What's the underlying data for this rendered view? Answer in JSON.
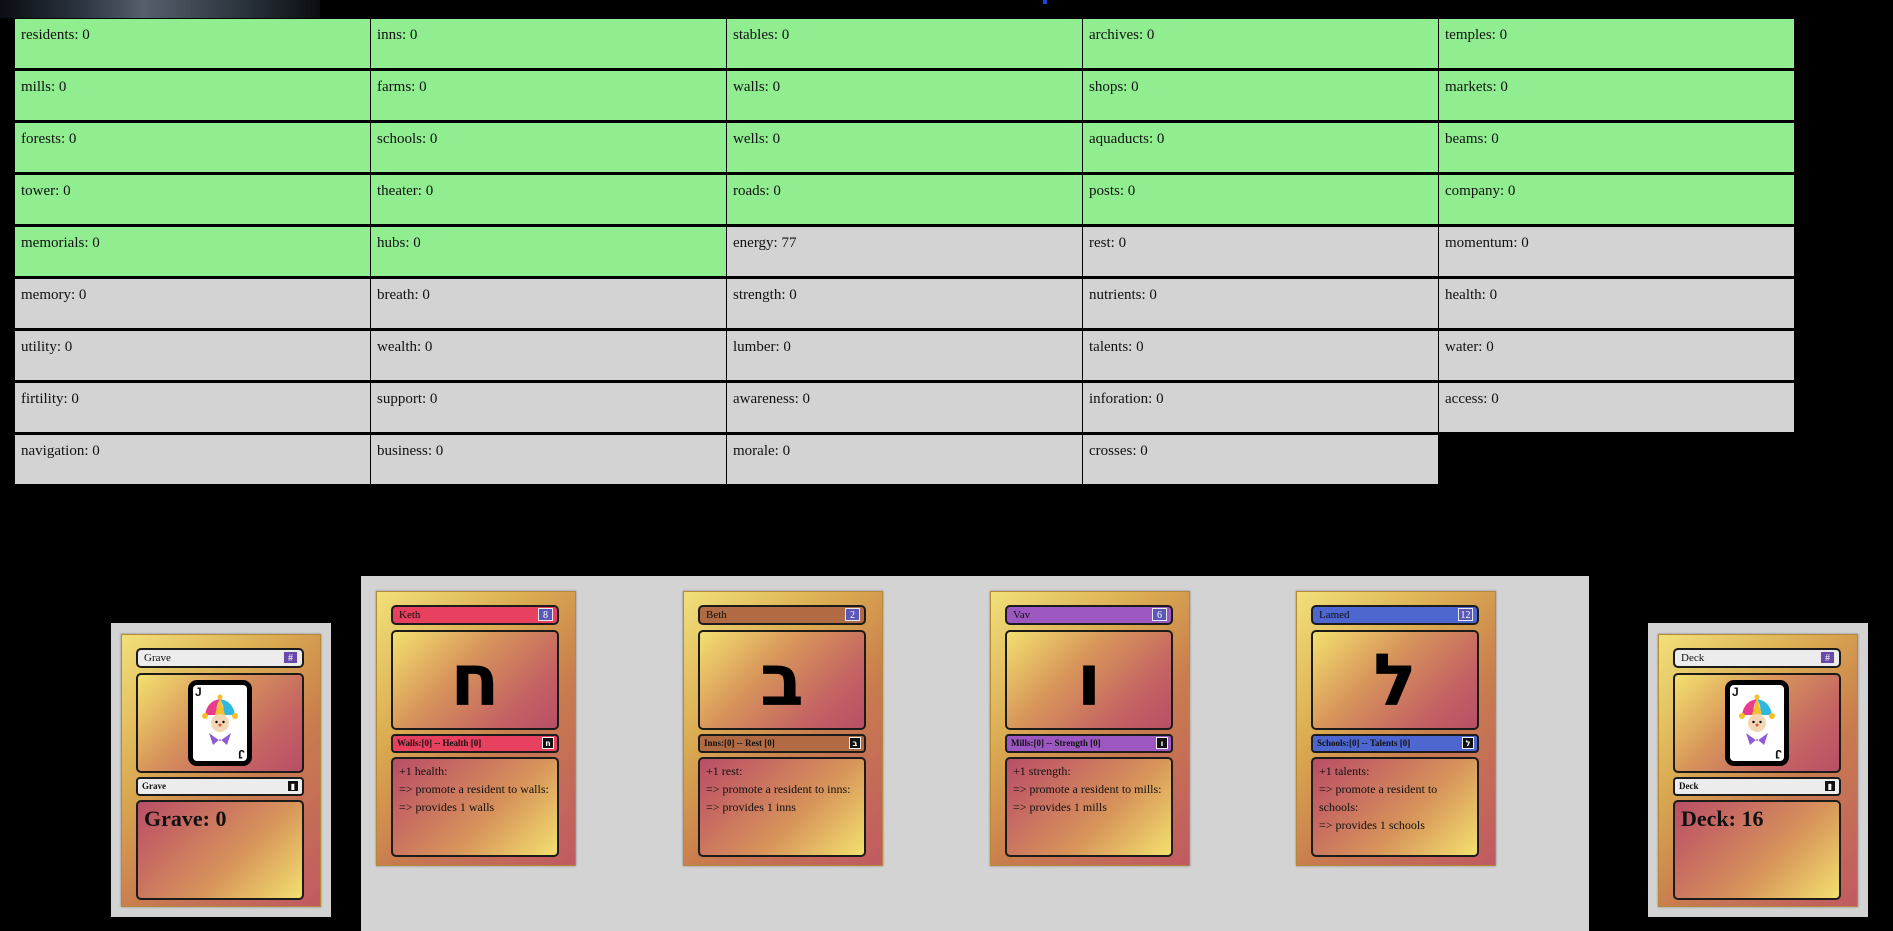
{
  "colors": {
    "built_cell": "#90ee90",
    "resource_cell": "#d3d3d3",
    "card_gold": "#e9c45e",
    "card_rose": "#c05a62"
  },
  "stats": [
    {
      "label": "residents: 0",
      "built": true
    },
    {
      "label": "inns: 0",
      "built": true
    },
    {
      "label": "stables: 0",
      "built": true
    },
    {
      "label": "archives: 0",
      "built": true
    },
    {
      "label": "temples: 0",
      "built": true
    },
    {
      "label": "mills: 0",
      "built": true
    },
    {
      "label": "farms: 0",
      "built": true
    },
    {
      "label": "walls: 0",
      "built": true
    },
    {
      "label": "shops: 0",
      "built": true
    },
    {
      "label": "markets: 0",
      "built": true
    },
    {
      "label": "forests: 0",
      "built": true
    },
    {
      "label": "schools: 0",
      "built": true
    },
    {
      "label": "wells: 0",
      "built": true
    },
    {
      "label": "aquaducts: 0",
      "built": true
    },
    {
      "label": "beams: 0",
      "built": true
    },
    {
      "label": "tower: 0",
      "built": true
    },
    {
      "label": "theater: 0",
      "built": true
    },
    {
      "label": "roads: 0",
      "built": true
    },
    {
      "label": "posts: 0",
      "built": true
    },
    {
      "label": "company: 0",
      "built": true
    },
    {
      "label": "memorials: 0",
      "built": true
    },
    {
      "label": "hubs: 0",
      "built": true
    },
    {
      "label": "energy: 77",
      "built": false
    },
    {
      "label": "rest: 0",
      "built": false
    },
    {
      "label": "momentum: 0",
      "built": false
    },
    {
      "label": "memory: 0",
      "built": false
    },
    {
      "label": "breath: 0",
      "built": false
    },
    {
      "label": "strength: 0",
      "built": false
    },
    {
      "label": "nutrients: 0",
      "built": false
    },
    {
      "label": "health: 0",
      "built": false
    },
    {
      "label": "utility: 0",
      "built": false
    },
    {
      "label": "wealth: 0",
      "built": false
    },
    {
      "label": "lumber: 0",
      "built": false
    },
    {
      "label": "talents: 0",
      "built": false
    },
    {
      "label": "water: 0",
      "built": false
    },
    {
      "label": "firtility: 0",
      "built": false
    },
    {
      "label": "support: 0",
      "built": false
    },
    {
      "label": "awareness: 0",
      "built": false
    },
    {
      "label": "inforation: 0",
      "built": false
    },
    {
      "label": "access: 0",
      "built": false
    },
    {
      "label": "navigation: 0",
      "built": false
    },
    {
      "label": "business: 0",
      "built": false
    },
    {
      "label": "morale: 0",
      "built": false
    },
    {
      "label": "crosses: 0",
      "built": false
    }
  ],
  "grave": {
    "title": "Grave",
    "cost": "#",
    "type": "Grave",
    "count_text": "Grave: 0"
  },
  "deck": {
    "title": "Deck",
    "cost": "#",
    "type": "Deck",
    "count_text": "Deck: 16"
  },
  "hand": [
    {
      "name": "Keth",
      "cost": "8",
      "glyph": "ח",
      "tag_glyph": "ח",
      "color": "#e8405f",
      "type": "Walls:[0] -- Health [0]",
      "lines": [
        "+1 health:",
        "=> promote a resident to walls:",
        "=> provides 1 walls"
      ]
    },
    {
      "name": "Beth",
      "cost": "2",
      "glyph": "ב",
      "tag_glyph": "ב",
      "color": "#b06a44",
      "type": "Inns:[0] -- Rest [0]",
      "lines": [
        "+1 rest:",
        "=> promote a resident to inns:",
        "=> provides 1 inns"
      ]
    },
    {
      "name": "Vav",
      "cost": "6",
      "glyph": "ו",
      "tag_glyph": "ו",
      "color": "#9c58c0",
      "type": "Mills:[0] -- Strength [0]",
      "lines": [
        "+1 strength:",
        "=> promote a resident to mills:",
        "=> provides 1 mills"
      ]
    },
    {
      "name": "Lamed",
      "cost": "12",
      "glyph": "ל",
      "tag_glyph": "ל",
      "color": "#4e67d0",
      "type": "Schools:[0] -- Talents [0]",
      "lines": [
        "+1 talents:",
        "=> promote a resident to",
        "schools:",
        "=> provides 1 schools"
      ]
    }
  ]
}
